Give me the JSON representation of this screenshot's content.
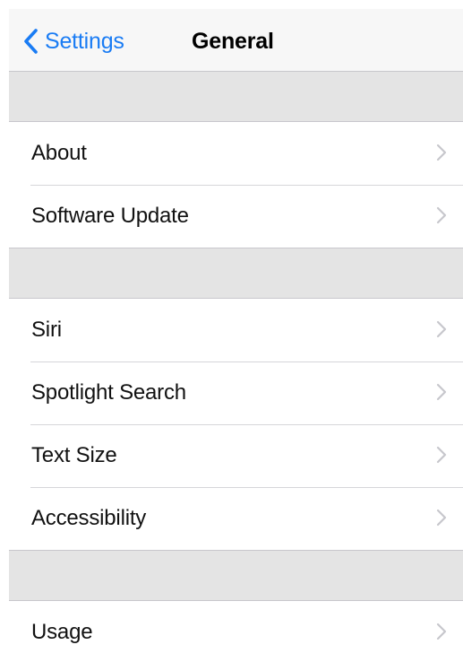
{
  "navbar": {
    "back_label": "Settings",
    "title": "General",
    "back_icon": "chevron-left-icon",
    "accent_color": "#1a7cf4"
  },
  "groups": [
    {
      "items": [
        {
          "label": "About",
          "icon": "chevron-right-icon"
        },
        {
          "label": "Software Update",
          "icon": "chevron-right-icon"
        }
      ]
    },
    {
      "items": [
        {
          "label": "Siri",
          "icon": "chevron-right-icon"
        },
        {
          "label": "Spotlight Search",
          "icon": "chevron-right-icon"
        },
        {
          "label": "Text Size",
          "icon": "chevron-right-icon"
        },
        {
          "label": "Accessibility",
          "icon": "chevron-right-icon"
        }
      ]
    },
    {
      "items": [
        {
          "label": "Usage",
          "icon": "chevron-right-icon"
        }
      ]
    }
  ],
  "colors": {
    "background": "#e4e4e4",
    "cell": "#ffffff",
    "separator": "#c8c7cc",
    "chevron": "#c7c7cc",
    "text": "#111111"
  }
}
